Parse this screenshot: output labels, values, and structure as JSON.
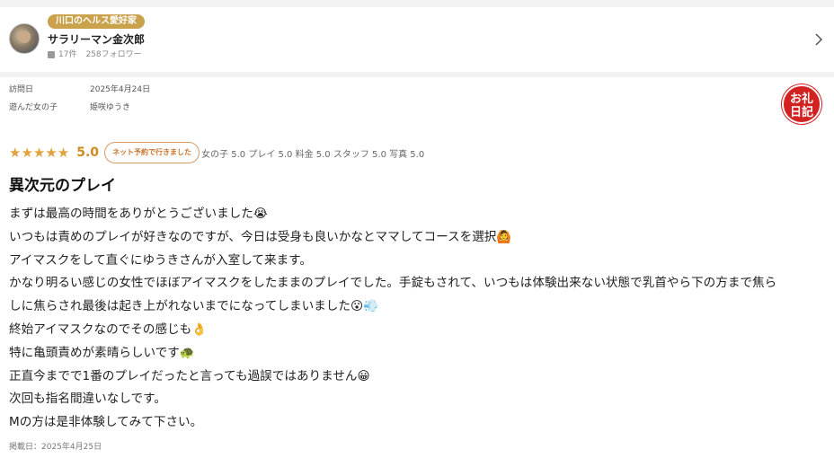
{
  "profile": {
    "badge": "川口のヘルス愛好家",
    "name": "サラリーマン金次郎",
    "posts": "17件",
    "followers": "258フォロワー"
  },
  "visit": {
    "date_label": "訪問日",
    "date_value": "2025年4月24日",
    "girl_label": "遊んだ女の子",
    "girl_value": "姫咲ゆうき"
  },
  "stamp": {
    "line1": "お礼",
    "line2": "日記"
  },
  "rating": {
    "stars": "★★★★★",
    "overall": "5.0",
    "net_booking": "ネット予約で行きました",
    "breakdown": "女の子 5.0 プレイ 5.0 料金 5.0 スタッフ 5.0 写真 5.0"
  },
  "review": {
    "title": "異次元のプレイ",
    "lines": [
      "まずは最高の時間をありがとうございました😭",
      "いつもは責めのプレイが好きなのですが、今日は受身も良いかなとママしてコースを選択🙆",
      "アイマスクをして直ぐにゆうきさんが入室して来ます。",
      "かなり明るい感じの女性でほぼアイマスクをしたままのプレイでした。手錠もされて、いつもは体験出来ない状態で乳首やら下の方まで焦ら",
      "しに焦らされ最後は起き上がれないまでになってしまいました😮💨",
      "終始アイマスクなのでその感じも👌",
      "特に亀頭責めが素晴らしいです🐢",
      "正直今までで1番のプレイだったと言っても過誤ではありません😀",
      "次回も指名間違いなしです。",
      "Mの方は是非体験してみて下さい。"
    ],
    "posted": "掲載日：2025年4月25日"
  }
}
